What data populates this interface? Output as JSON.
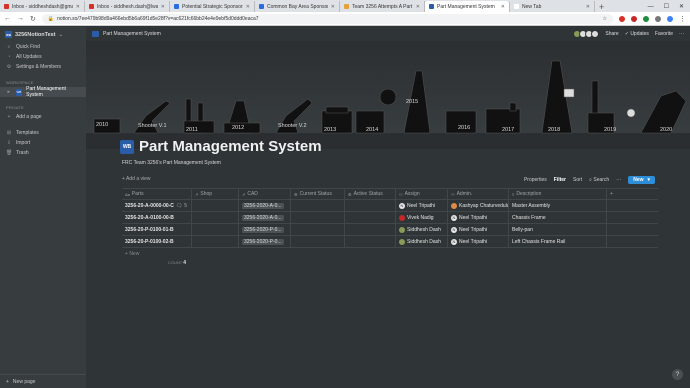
{
  "browser": {
    "tabs": [
      {
        "label": "Inbox - siddheshdash@gmail.co...",
        "color": "#d93025"
      },
      {
        "label": "Inbox - siddhesh.dash@lwamark...",
        "color": "#d93025"
      },
      {
        "label": "Potential Strategic Sponsorship I...",
        "color": "#2a6be2"
      },
      {
        "label": "Common Bay Area Sponsors Mi...",
        "color": "#2a6be2"
      },
      {
        "label": "Team 3256 Attempts A Part Ma...",
        "color": "#e8a13a"
      },
      {
        "label": "Part Management System",
        "color": "#2a5ca8"
      },
      {
        "label": "New Tab",
        "color": "#ffffff"
      }
    ],
    "url": "notion.so/7ee479b98d9a466ebd5b6a69f1d5e28f?v=ac621fc66bb24e4e9ebf5d0ddd0eaca7"
  },
  "sidebar": {
    "workspace": "3256NotionTest",
    "top_items": [
      {
        "icon": "⌕",
        "label": "Quick Find"
      },
      {
        "icon": "◔",
        "label": "All Updates"
      },
      {
        "icon": "⚙",
        "label": "Settings & Members"
      }
    ],
    "workspace_heading": "WORKSPACE",
    "workspace_page": "Part Management System",
    "private_heading": "PRIVATE",
    "add_page": "Add a page",
    "bottom_items": [
      {
        "icon": "⊞",
        "label": "Templates"
      },
      {
        "icon": "⇩",
        "label": "Import"
      },
      {
        "icon": "🗑",
        "label": "Trash"
      }
    ],
    "new_page": "New page"
  },
  "topbar": {
    "breadcrumb": "Part Management System",
    "share": "Share",
    "updates": "Updates",
    "favorite": "Favorite",
    "more": "···"
  },
  "cover": {
    "years": [
      "2010",
      "Shooter V.1",
      "2011",
      "2012",
      "Shooter V.2",
      "2013",
      "2014",
      "2015",
      "2016",
      "2017",
      "2018",
      "2019",
      "2020"
    ]
  },
  "page": {
    "icon_text": "WB",
    "title": "Part Management System",
    "subtitle": "FRC Team 3256's Part Management System",
    "add_view": "Add a view",
    "controls": {
      "properties": "Properties",
      "filter": "Filter",
      "sort": "Sort",
      "search": "Search",
      "more": "···",
      "new": "New"
    }
  },
  "table": {
    "headers": [
      "Parts",
      "Shop",
      "CAD",
      "Current Status",
      "Active Status",
      "Assign",
      "Admin.",
      "Description"
    ],
    "rows": [
      {
        "part": "3256-20-A-0000-00-C",
        "comments": "5",
        "cad": "3256-2020-A-0...",
        "assign": "Neel Tripathi",
        "admin": "Kashyap Chaturvedula",
        "desc": "Master Assembly"
      },
      {
        "part": "3256-20-A-0100-00-B",
        "comments": "",
        "cad": "3256-2020-A-0...",
        "assign": "Vivek Nadig",
        "admin": "Neel Tripathi",
        "desc": "Chassis Frame"
      },
      {
        "part": "3256-20-P-0100-01-B",
        "comments": "",
        "cad": "3256-2020-P-0...",
        "assign": "Siddhesh Dash",
        "admin": "Neel Tripathi",
        "desc": "Belly-pan"
      },
      {
        "part": "3256-20-P-0100-02-B",
        "comments": "",
        "cad": "3256-2020-P-0...",
        "assign": "Siddhesh Dash",
        "admin": "Neel Tripathi",
        "desc": "Left Chassis Frame Rail"
      }
    ],
    "new_row": "New",
    "count_label": "COUNT",
    "count_value": "4"
  },
  "help": "?"
}
